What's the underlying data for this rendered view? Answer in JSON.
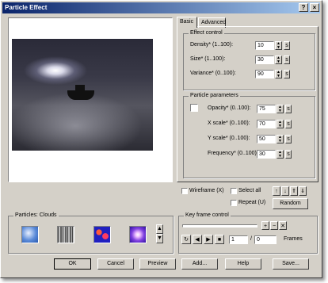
{
  "window": {
    "title": "Particle Effect",
    "help_glyph": "?",
    "close_glyph": "×"
  },
  "tabs": [
    {
      "label": "Basic"
    },
    {
      "label": "Advanced"
    }
  ],
  "effect_control": {
    "title": "Effect control",
    "density": {
      "label": "Density* (1..100):",
      "value": "10"
    },
    "size": {
      "label": "Size* (1..100):",
      "value": "30"
    },
    "variance": {
      "label": "Variance* (0..100):",
      "value": "90"
    }
  },
  "particle_parameters": {
    "title": "Particle parameters",
    "opacity": {
      "label": "Opacity* (0..100):",
      "value": "75"
    },
    "xscale": {
      "label": "X scale* (0..100):",
      "value": "70"
    },
    "yscale": {
      "label": "Y scale* (0..100):",
      "value": "50"
    },
    "frequency": {
      "label": "Frequency* (0..100):",
      "value": "30"
    }
  },
  "options": {
    "wireframe": "Wireframe (X)",
    "select_all": "Select all",
    "repeat": "Repeat (U)",
    "random": "Random"
  },
  "particles": {
    "title": "Particles: Clouds"
  },
  "keyframe": {
    "title": "Key frame control",
    "frame_value": "1",
    "frames_total": "0",
    "frames_label": "Frames",
    "slash": "/"
  },
  "buttons": {
    "ok": "OK",
    "cancel": "Cancel",
    "preview": "Preview",
    "add": "Add...",
    "help": "Help",
    "save": "Save..."
  },
  "glyphs": {
    "up": "▲",
    "down": "▼",
    "s": "s",
    "play": "▶",
    "stop": "■",
    "loop": "↻",
    "back": "◀"
  }
}
